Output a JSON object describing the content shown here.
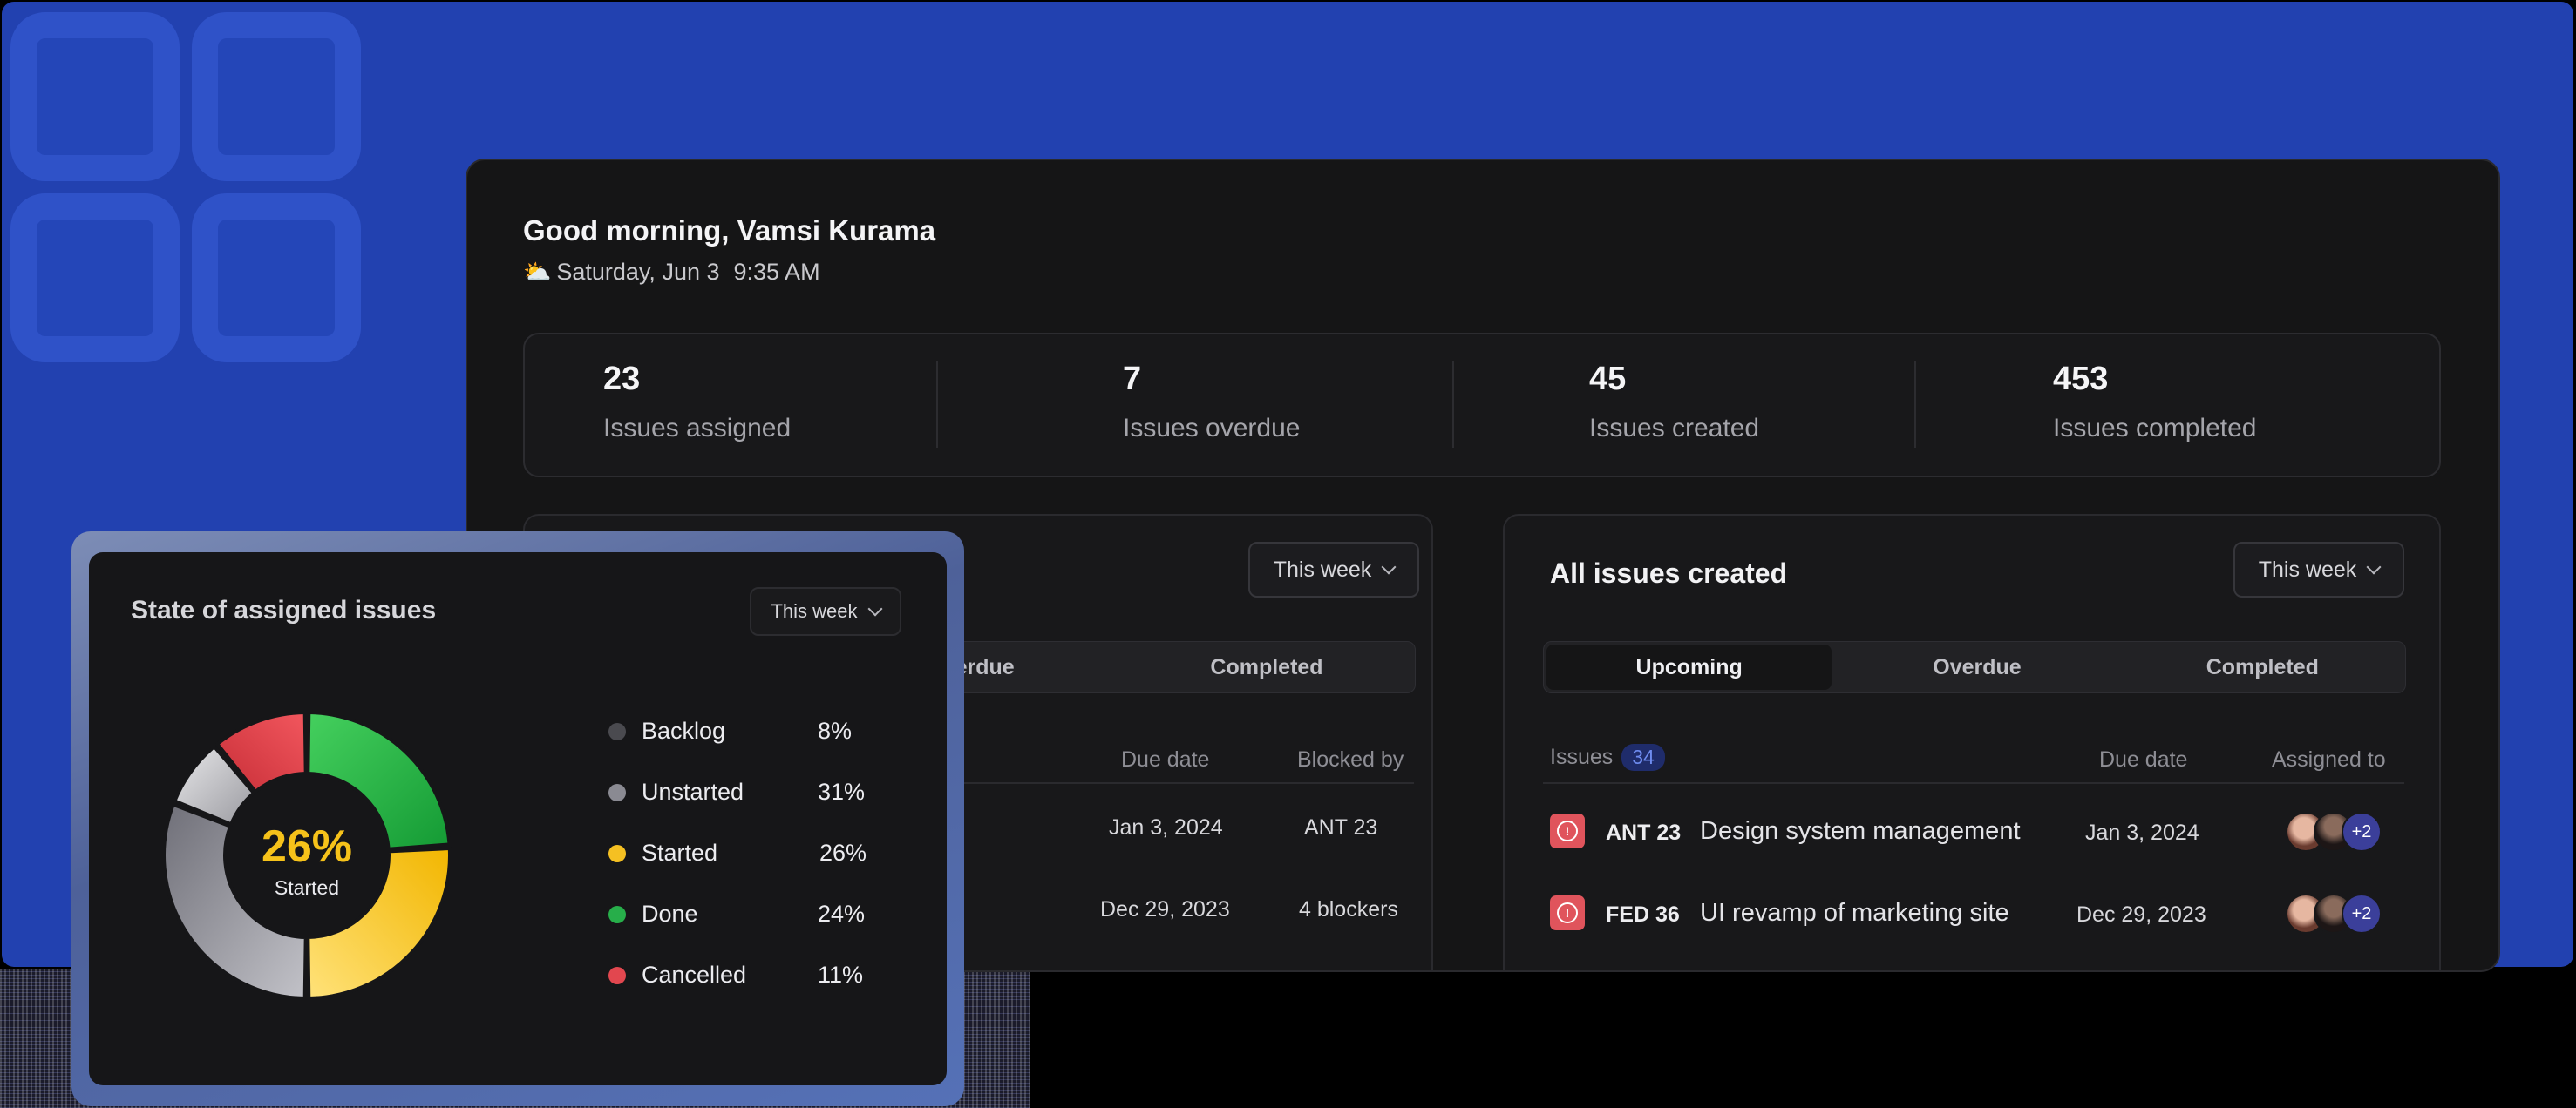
{
  "header": {
    "greeting": "Good morning, Vamsi Kurama",
    "weather_icon": "partly-sunny-icon",
    "date": "Saturday, Jun 3",
    "time": "9:35 AM"
  },
  "stats": [
    {
      "value": "23",
      "label": "Issues assigned"
    },
    {
      "value": "7",
      "label": "Issues overdue"
    },
    {
      "value": "45",
      "label": "Issues created"
    },
    {
      "value": "453",
      "label": "Issues completed"
    }
  ],
  "assigned_card": {
    "filter": "This week",
    "tabs": [
      "Overdue",
      "Completed"
    ],
    "columns": [
      "Due date",
      "Blocked by"
    ],
    "rows": [
      {
        "due": "Jan 3, 2024",
        "blocked_by": "ANT 23"
      },
      {
        "due": "Dec 29, 2023",
        "blocked_by": "4 blockers"
      }
    ]
  },
  "created_card": {
    "title": "All issues created",
    "filter": "This week",
    "tabs": [
      "Upcoming",
      "Overdue",
      "Completed"
    ],
    "active_tab": "Upcoming",
    "columns": {
      "issues": "Issues",
      "issues_count": "34",
      "due": "Due date",
      "assigned": "Assigned to"
    },
    "rows": [
      {
        "id": "ANT 23",
        "title": "Design system management",
        "due": "Jan 3, 2024",
        "more_assignees": "+2"
      },
      {
        "id": "FED 36",
        "title": "UI revamp of marketing site",
        "due": "Dec 29, 2023",
        "more_assignees": "+2"
      }
    ]
  },
  "state_card": {
    "title": "State of assigned issues",
    "filter": "This week",
    "center_value": "26%",
    "center_label": "Started",
    "legend": [
      {
        "label": "Backlog",
        "pct": "8%",
        "color": "#4a4a4f"
      },
      {
        "label": "Unstarted",
        "pct": "31%",
        "color": "#8a8a92"
      },
      {
        "label": "Started",
        "pct": "26%",
        "color": "#f5c022"
      },
      {
        "label": "Done",
        "pct": "24%",
        "color": "#27ae4a"
      },
      {
        "label": "Cancelled",
        "pct": "11%",
        "color": "#e2474f"
      }
    ]
  },
  "chart_data": {
    "type": "pie",
    "categories": [
      "Backlog",
      "Unstarted",
      "Started",
      "Done",
      "Cancelled"
    ],
    "values": [
      8,
      31,
      26,
      24,
      11
    ],
    "colors": {
      "Backlog": "#4a4a4f",
      "Unstarted": "#8a8a92",
      "Started": "#f5c022",
      "Done": "#27ae4a",
      "Cancelled": "#e2474f"
    }
  },
  "theme": {
    "accent": "#2241b0",
    "panel": "#151516",
    "alert": "#e0545c"
  }
}
